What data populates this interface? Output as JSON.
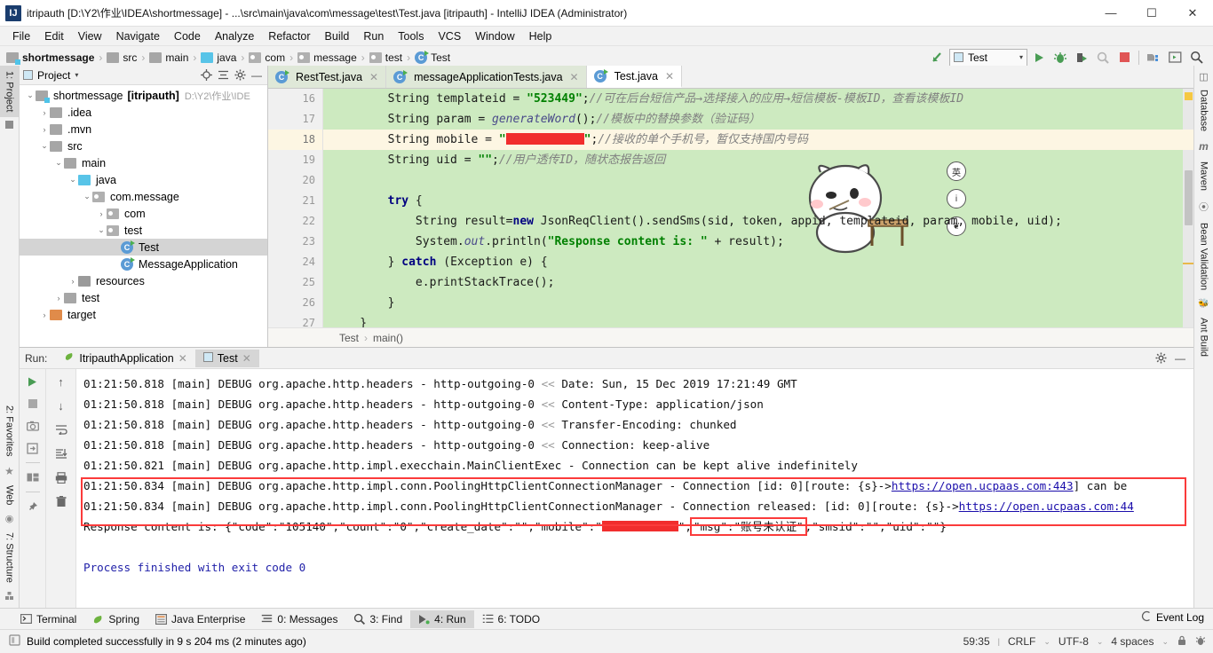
{
  "window": {
    "title": "itripauth [D:\\Y2\\作业\\IDEA\\shortmessage] - ...\\src\\main\\java\\com\\message\\test\\Test.java [itripauth] - IntelliJ IDEA (Administrator)",
    "logo": "IJ",
    "minimize": "—",
    "maximize": "☐",
    "close": "✕"
  },
  "menubar": {
    "items": [
      "File",
      "Edit",
      "View",
      "Navigate",
      "Code",
      "Analyze",
      "Refactor",
      "Build",
      "Run",
      "Tools",
      "VCS",
      "Window",
      "Help"
    ]
  },
  "toolbar": {
    "breadcrumbs": [
      {
        "label": "shortmessage",
        "icon": "module-icon",
        "bold": true
      },
      {
        "label": "src",
        "icon": "folder-icon",
        "bold": false
      },
      {
        "label": "main",
        "icon": "folder-icon",
        "bold": false
      },
      {
        "label": "java",
        "icon": "source-folder-icon",
        "bold": false
      },
      {
        "label": "com",
        "icon": "package-icon",
        "bold": false
      },
      {
        "label": "message",
        "icon": "package-icon",
        "bold": false
      },
      {
        "label": "test",
        "icon": "package-icon",
        "bold": false
      },
      {
        "label": "Test",
        "icon": "class-icon",
        "bold": false
      }
    ],
    "separator": "›",
    "run_config": "Test",
    "icons": [
      "back-arrow-icon",
      "run-icon",
      "debug-icon",
      "run-coverage-icon",
      "profile-icon",
      "stop-icon",
      "project-structure-icon",
      "terminal-icon",
      "search-everywhere-icon"
    ]
  },
  "left_stripe": [
    {
      "label": "1: Project",
      "selected": true
    },
    {
      "label": "2: Favorites",
      "selected": false
    },
    {
      "label": "Web",
      "selected": false
    },
    {
      "label": "7: Structure",
      "selected": false
    }
  ],
  "right_stripe": [
    {
      "label": "Database"
    },
    {
      "label": "Maven"
    },
    {
      "label": "Bean Validation"
    },
    {
      "label": "Ant Build"
    }
  ],
  "project_panel": {
    "title": "Project",
    "dropdown": "▾",
    "actions": [
      "locate-icon",
      "collapse-all-icon",
      "settings-icon",
      "hide-icon"
    ],
    "tree": [
      {
        "indent": 0,
        "arrow": "⌄",
        "icon": "module",
        "label": "shortmessage",
        "bold_suffix": "[itripauth]",
        "dim": "D:\\Y2\\作业\\IDE",
        "selected": false
      },
      {
        "indent": 1,
        "arrow": "›",
        "icon": "folder",
        "label": ".idea",
        "selected": false
      },
      {
        "indent": 1,
        "arrow": "›",
        "icon": "folder",
        "label": ".mvn",
        "selected": false
      },
      {
        "indent": 1,
        "arrow": "⌄",
        "icon": "folder",
        "label": "src",
        "selected": false
      },
      {
        "indent": 2,
        "arrow": "⌄",
        "icon": "folder",
        "label": "main",
        "selected": false
      },
      {
        "indent": 3,
        "arrow": "⌄",
        "icon": "source",
        "label": "java",
        "selected": false
      },
      {
        "indent": 4,
        "arrow": "⌄",
        "icon": "package",
        "label": "com.message",
        "selected": false
      },
      {
        "indent": 5,
        "arrow": "›",
        "icon": "package",
        "label": "com",
        "selected": false
      },
      {
        "indent": 5,
        "arrow": "⌄",
        "icon": "package",
        "label": "test",
        "selected": false
      },
      {
        "indent": 6,
        "arrow": "",
        "icon": "class-run",
        "label": "Test",
        "selected": true
      },
      {
        "indent": 6,
        "arrow": "",
        "icon": "class-spring",
        "label": "MessageApplication",
        "selected": false
      },
      {
        "indent": 3,
        "arrow": "›",
        "icon": "resources",
        "label": "resources",
        "selected": false
      },
      {
        "indent": 2,
        "arrow": "›",
        "icon": "folder",
        "label": "test",
        "selected": false
      },
      {
        "indent": 1,
        "arrow": "›",
        "icon": "target",
        "label": "target",
        "selected": false
      }
    ]
  },
  "editor": {
    "tabs": [
      {
        "label": "RestTest.java",
        "active": false,
        "close": "✕"
      },
      {
        "label": "messageApplicationTests.java",
        "active": false,
        "close": "✕"
      },
      {
        "label": "Test.java",
        "active": true,
        "close": "✕"
      }
    ],
    "lines": [
      {
        "no": "16",
        "fold": false,
        "hl": false,
        "segments": [
          {
            "t": "        String templateid = ",
            "c": "plain"
          },
          {
            "t": "\"523449\"",
            "c": "str"
          },
          {
            "t": ";",
            "c": "plain"
          },
          {
            "t": "//可在后台短信产品→选择接入的应用→短信模板-模板ID，查看该模板ID",
            "c": "cmt"
          }
        ]
      },
      {
        "no": "17",
        "fold": false,
        "hl": false,
        "segments": [
          {
            "t": "        String param = ",
            "c": "plain"
          },
          {
            "t": "generateWord",
            "c": "fld"
          },
          {
            "t": "();",
            "c": "plain"
          },
          {
            "t": "//模板中的替换参数（验证码）",
            "c": "cmt"
          }
        ]
      },
      {
        "no": "18",
        "fold": false,
        "hl": true,
        "segments": [
          {
            "t": "        String mobile = ",
            "c": "plain"
          },
          {
            "t": "\"",
            "c": "str"
          },
          {
            "t": "",
            "c": "redact"
          },
          {
            "t": "\"",
            "c": "str"
          },
          {
            "t": ";",
            "c": "plain"
          },
          {
            "t": "//接收的单个手机号，暂仅支持国内号码",
            "c": "cmt"
          }
        ]
      },
      {
        "no": "19",
        "fold": false,
        "hl": false,
        "segments": [
          {
            "t": "        String uid = ",
            "c": "plain"
          },
          {
            "t": "\"\"",
            "c": "str"
          },
          {
            "t": ";",
            "c": "plain"
          },
          {
            "t": "//用户透传ID，随状态报告返回",
            "c": "cmt"
          }
        ]
      },
      {
        "no": "20",
        "fold": false,
        "hl": false,
        "segments": [
          {
            "t": "",
            "c": "plain"
          }
        ]
      },
      {
        "no": "21",
        "fold": true,
        "hl": false,
        "segments": [
          {
            "t": "        ",
            "c": "plain"
          },
          {
            "t": "try",
            "c": "kw"
          },
          {
            "t": " {",
            "c": "plain"
          }
        ]
      },
      {
        "no": "22",
        "fold": false,
        "hl": false,
        "segments": [
          {
            "t": "            String result=",
            "c": "plain"
          },
          {
            "t": "new",
            "c": "kw"
          },
          {
            "t": " JsonReqClient().sendSms(sid, token, appid, templateid, param, mobile, uid);",
            "c": "plain"
          }
        ]
      },
      {
        "no": "23",
        "fold": false,
        "hl": false,
        "segments": [
          {
            "t": "            System.",
            "c": "plain"
          },
          {
            "t": "out",
            "c": "fld"
          },
          {
            "t": ".println(",
            "c": "plain"
          },
          {
            "t": "\"Response content is: \"",
            "c": "str"
          },
          {
            "t": " + result);",
            "c": "plain"
          }
        ]
      },
      {
        "no": "24",
        "fold": true,
        "hl": false,
        "segments": [
          {
            "t": "        } ",
            "c": "plain"
          },
          {
            "t": "catch",
            "c": "kw"
          },
          {
            "t": " (Exception e) {",
            "c": "plain"
          }
        ]
      },
      {
        "no": "25",
        "fold": false,
        "hl": false,
        "segments": [
          {
            "t": "            e.printStackTrace();",
            "c": "plain"
          }
        ]
      },
      {
        "no": "26",
        "fold": false,
        "hl": false,
        "segments": [
          {
            "t": "        }",
            "c": "plain"
          }
        ]
      },
      {
        "no": "27",
        "fold": false,
        "hl": false,
        "segments": [
          {
            "t": "    }",
            "c": "plain"
          }
        ]
      }
    ],
    "breadcrumb": [
      "Test",
      "main()"
    ],
    "breadcrumb_sep": "›",
    "ime": {
      "lang_badge": "英",
      "info_badge": "i",
      "skin_badge": "❦"
    }
  },
  "run_panel": {
    "label": "Run:",
    "tabs": [
      {
        "label": "ItripauthApplication",
        "active": false,
        "close": "✕",
        "icon": "spring-icon"
      },
      {
        "label": "Test",
        "active": true,
        "close": "✕",
        "icon": "test-icon"
      }
    ],
    "head_actions": [
      "settings-icon",
      "hide-icon"
    ],
    "left_tools": [
      "rerun-icon",
      "stop-icon",
      "screenshot-icon",
      "export-icon",
      "layout-icon",
      "pin-icon"
    ],
    "mid_tools": [
      "up-arrow-icon",
      "down-arrow-icon",
      "soft-wrap-icon",
      "scroll-end-icon",
      "print-icon",
      "trash-icon"
    ],
    "console_lines": [
      {
        "parts": [
          {
            "t": "01:21:50.818 [main] DEBUG org.apache.http.headers - http-outgoing-0 ",
            "c": "plain"
          },
          {
            "t": "<<",
            "c": "dim"
          },
          {
            "t": " Date: Sun, 15 Dec 2019 17:21:49 GMT",
            "c": "plain"
          }
        ]
      },
      {
        "parts": [
          {
            "t": "01:21:50.818 [main] DEBUG org.apache.http.headers - http-outgoing-0 ",
            "c": "plain"
          },
          {
            "t": "<<",
            "c": "dim"
          },
          {
            "t": " Content-Type: application/json",
            "c": "plain"
          }
        ]
      },
      {
        "parts": [
          {
            "t": "01:21:50.818 [main] DEBUG org.apache.http.headers - http-outgoing-0 ",
            "c": "plain"
          },
          {
            "t": "<<",
            "c": "dim"
          },
          {
            "t": " Transfer-Encoding: chunked",
            "c": "plain"
          }
        ]
      },
      {
        "parts": [
          {
            "t": "01:21:50.818 [main] DEBUG org.apache.http.headers - http-outgoing-0 ",
            "c": "plain"
          },
          {
            "t": "<<",
            "c": "dim"
          },
          {
            "t": " Connection: keep-alive",
            "c": "plain"
          }
        ]
      },
      {
        "parts": [
          {
            "t": "01:21:50.821 [main] DEBUG org.apache.http.impl.execchain.MainClientExec - Connection can be kept alive indefinitely",
            "c": "plain"
          }
        ]
      },
      {
        "parts": [
          {
            "t": "01:21:50.834 [main] DEBUG org.apache.http.impl.conn.PoolingHttpClientConnectionManager - Connection [id: 0][route: {s}->",
            "c": "plain"
          },
          {
            "t": "https://open.ucpaas.com:443",
            "c": "link"
          },
          {
            "t": "] can be ",
            "c": "plain"
          }
        ]
      },
      {
        "parts": [
          {
            "t": "01:21:50.834 [main] DEBUG org.apache.http.impl.conn.PoolingHttpClientConnectionManager - Connection released: [id: 0][route: {s}->",
            "c": "plain"
          },
          {
            "t": "https://open.ucpaas.com:44",
            "c": "link"
          }
        ]
      },
      {
        "parts": [
          {
            "t": "Response content is: {\"code\":\"105140\",\"count\":\"0\",\"create_date\":\"\",\"mobile\":\"",
            "c": "plain"
          },
          {
            "t": "",
            "c": "redact"
          },
          {
            "t": "\",",
            "c": "plain"
          },
          {
            "t": "\"msg\":\"账号未认证\"",
            "c": "boxed"
          },
          {
            "t": ",\"smsid\":\"\",\"uid\":\"\"}",
            "c": "plain"
          }
        ]
      },
      {
        "parts": [
          {
            "t": "",
            "c": "plain"
          }
        ]
      },
      {
        "parts": [
          {
            "t": "Process finished with exit code 0",
            "c": "exit"
          }
        ]
      }
    ]
  },
  "tool_windows": {
    "items": [
      {
        "label": "Terminal",
        "icon": "terminal-icon",
        "active": false
      },
      {
        "label": "Spring",
        "icon": "spring-icon",
        "active": false
      },
      {
        "label": "Java Enterprise",
        "icon": "java-ee-icon",
        "active": false
      },
      {
        "label": "0: Messages",
        "icon": "messages-icon",
        "active": false
      },
      {
        "label": "3: Find",
        "icon": "find-icon",
        "active": false
      },
      {
        "label": "4: Run",
        "icon": "run-icon",
        "active": true
      },
      {
        "label": "6: TODO",
        "icon": "todo-icon",
        "active": false
      }
    ],
    "event_log": "Event Log"
  },
  "status_bar": {
    "message": "Build completed successfully in 9 s 204 ms (2 minutes ago)",
    "caret": "59:35",
    "line_sep": "CRLF",
    "encoding": "UTF-8",
    "indent": "4 spaces",
    "chevron": "⌄",
    "icons": [
      "lock-icon",
      "bug-icon"
    ]
  },
  "colors": {
    "code_bg": "#cdeac0",
    "highlight_line": "#fdf6e3",
    "redaction": "#f12d2d",
    "red_box": "#fb3b3b",
    "link": "#1a0dab",
    "accent_green": "#4caf50"
  }
}
